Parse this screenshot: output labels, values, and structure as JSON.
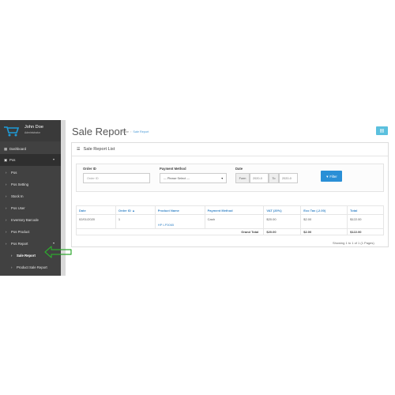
{
  "user": {
    "name": "John Doe",
    "role": "Administrator"
  },
  "sidebar": {
    "items": [
      {
        "label": "Dashboard",
        "icon": "dashboard-icon"
      },
      {
        "label": "Pos",
        "icon": "shopping-cart-icon"
      },
      {
        "label": "Pos",
        "icon": "chevron-right-icon"
      },
      {
        "label": "Pos Setting",
        "icon": "chevron-right-icon"
      },
      {
        "label": "Stock In",
        "icon": "chevron-right-icon"
      },
      {
        "label": "Pos User",
        "icon": "chevron-right-icon"
      },
      {
        "label": "Inventory Barcode",
        "icon": "chevron-right-icon"
      },
      {
        "label": "Pos Product",
        "icon": "chevron-right-icon"
      },
      {
        "label": "Pos Report",
        "icon": "chevron-right-icon"
      },
      {
        "label": "Sale Report",
        "icon": "chevron-right-icon"
      },
      {
        "label": "Product Sale Report",
        "icon": "chevron-right-icon"
      }
    ]
  },
  "page": {
    "title": "Sale Report",
    "breadcrumb": [
      "Home",
      "Sale Report"
    ]
  },
  "panel": {
    "title": "Sale Report List"
  },
  "filter": {
    "order_id_label": "Order ID",
    "order_id_placeholder": "Order ID",
    "payment_label": "Payment Method",
    "payment_value": "--- Please Select ---",
    "date_label": "Date",
    "form_label": "Form",
    "from_value": "2020-0",
    "to_label": "To",
    "to_value": "2020-0",
    "button_label": "Filter"
  },
  "table": {
    "headers": [
      "Date",
      "Order ID ▲",
      "Product Name",
      "Payment Method",
      "VAT (20%)",
      "Eco Tax (-2.00)",
      "Total"
    ],
    "rows": [
      [
        "02/01/2020",
        "1",
        "HP LP3065",
        "Cash",
        "$20.00",
        "$2.00",
        "$122.00"
      ]
    ],
    "grand_total": {
      "label": "Grand Total",
      "vat": "$20.00",
      "eco": "$2.00",
      "total": "$122.00"
    }
  },
  "showing": "Showing 1 to 1 of 1 (1 Pages)",
  "colors": {
    "sidebar": "#414141",
    "accent": "#2a8fd6",
    "link": "#3a87c8",
    "arrow": "#2ea82e"
  }
}
